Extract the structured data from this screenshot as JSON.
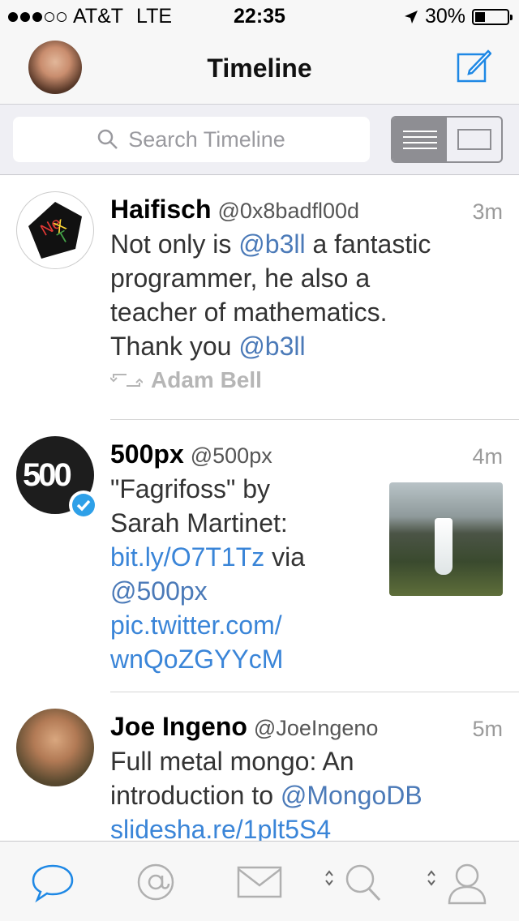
{
  "status": {
    "carrier": "AT&T",
    "network": "LTE",
    "time": "22:35",
    "battery": "30%",
    "signal_bars": 3
  },
  "nav": {
    "title": "Timeline"
  },
  "search": {
    "placeholder": "Search Timeline"
  },
  "tweets": [
    {
      "name": "Haifisch",
      "handle": "@0x8badfl00d",
      "time": "3m",
      "text_parts": [
        "Not only is ",
        "@b3ll",
        " a fantastic",
        "programmer, he also a",
        "teacher of mathematics.",
        "Thank you ",
        "@b3ll"
      ],
      "retweeted_by": "Adam Bell"
    },
    {
      "name": "500px",
      "handle": "@500px",
      "time": "4m",
      "verified": true,
      "text_parts": [
        "\"Fagrifoss\" by",
        "Sarah Martinet:",
        "bit.ly/O7T1Tz",
        " via",
        "@500px",
        "pic.twitter.com/",
        "wnQoZGYYcM"
      ],
      "avatar_text": "500"
    },
    {
      "name": "Joe Ingeno",
      "handle": "@JoeIngeno",
      "time": "5m",
      "text_parts": [
        "Full metal mongo: An",
        "introduction to ",
        "@MongoDB",
        "slidesha.re/1plt5S4"
      ]
    }
  ],
  "colors": {
    "accent": "#3a85d8",
    "mention": "#4b7ab8",
    "muted": "#9a9a9a"
  },
  "tabs": [
    "timeline-tab",
    "mentions-tab",
    "messages-tab",
    "search-tab",
    "profile-tab"
  ]
}
